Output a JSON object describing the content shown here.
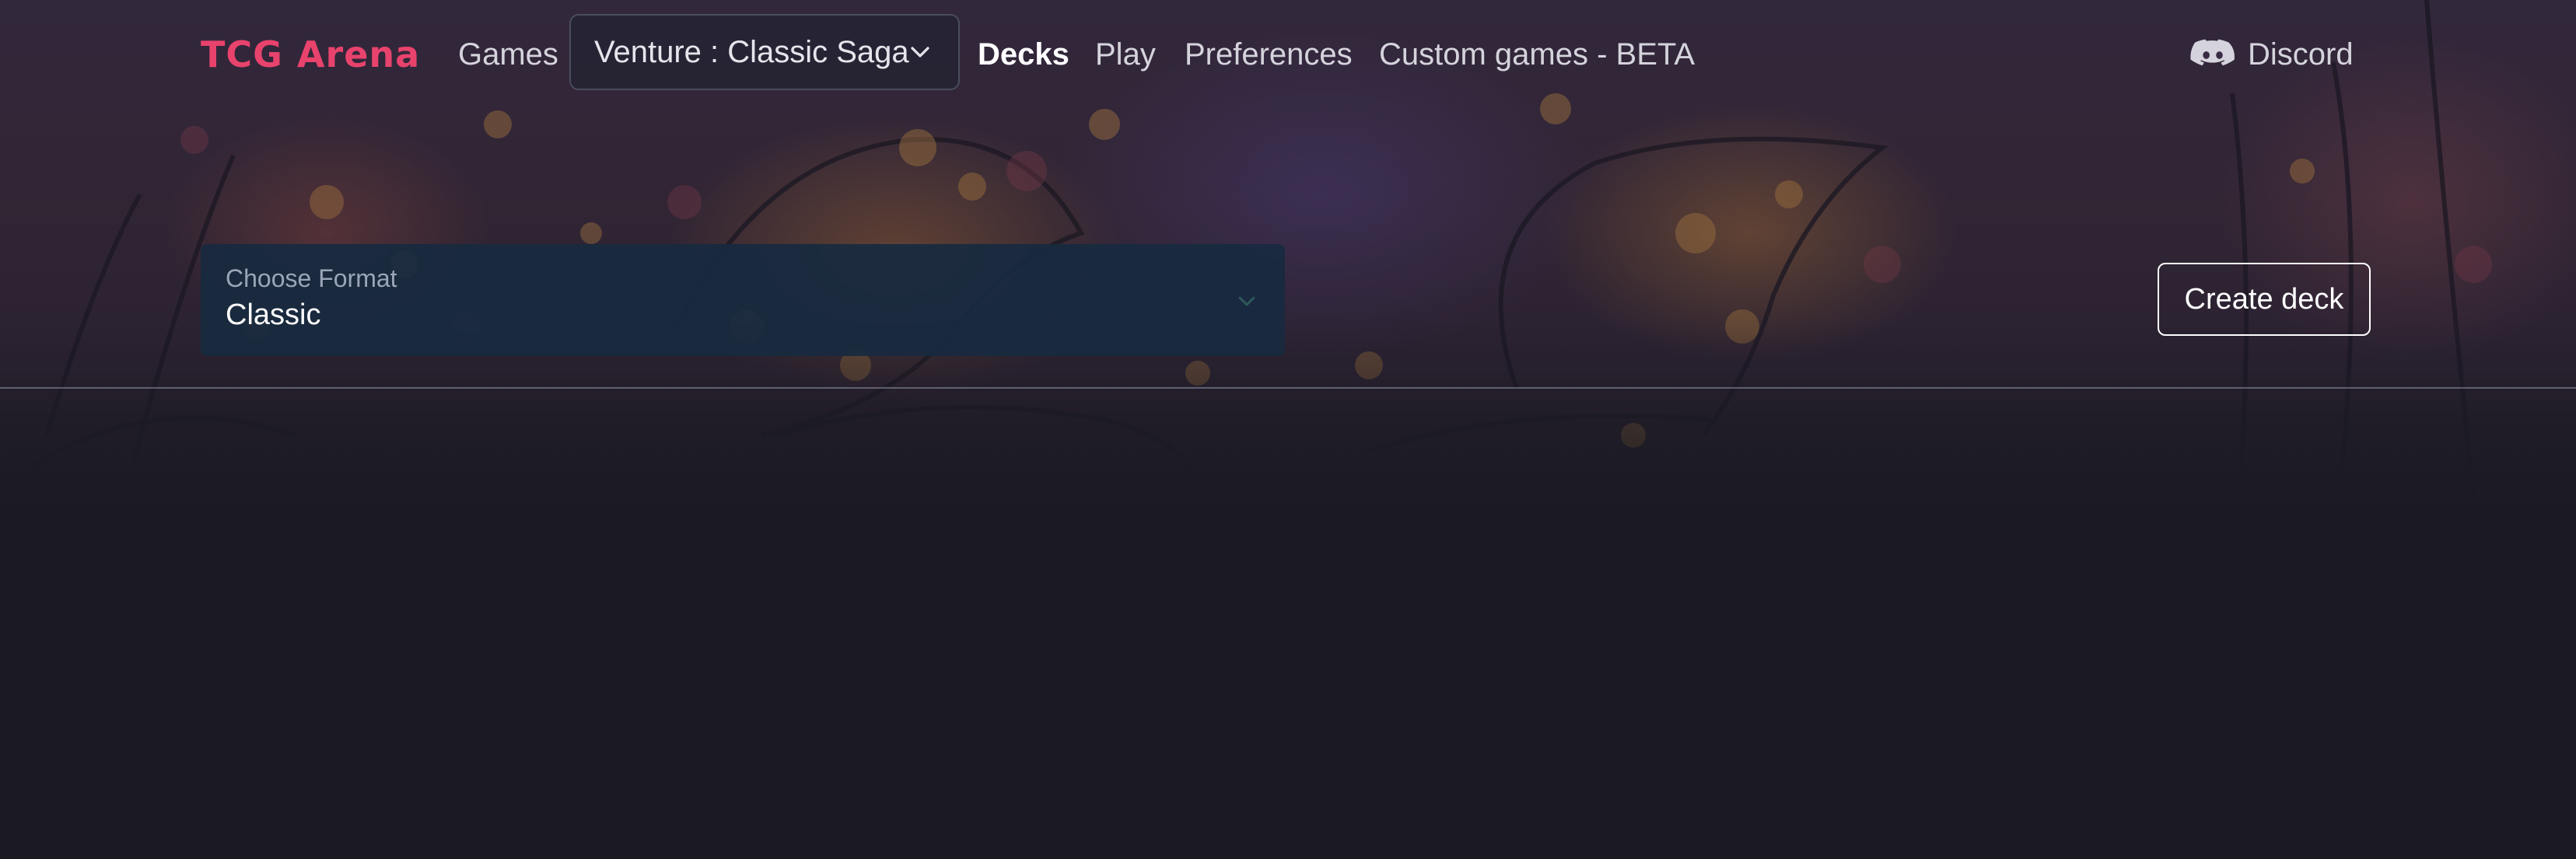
{
  "navbar": {
    "brand_part1": "TCG",
    "brand_part2": "Arena",
    "links": {
      "games": "Games",
      "decks": "Decks",
      "play": "Play",
      "preferences": "Preferences",
      "custom_games": "Custom games - BETA"
    },
    "game_selector": {
      "selected": "Venture : Classic Saga",
      "icon": "chevron-down-icon"
    },
    "discord": {
      "label": "Discord",
      "icon": "discord-icon"
    },
    "active_link": "Decks"
  },
  "format_filter": {
    "label": "Choose Format",
    "selected": "Classic",
    "icon": "chevron-down-icon"
  },
  "actions": {
    "create_deck_label": "Create deck"
  },
  "colors": {
    "brand": "#e8436d",
    "page_background": "#1b1a22",
    "format_box": "#182a40"
  }
}
